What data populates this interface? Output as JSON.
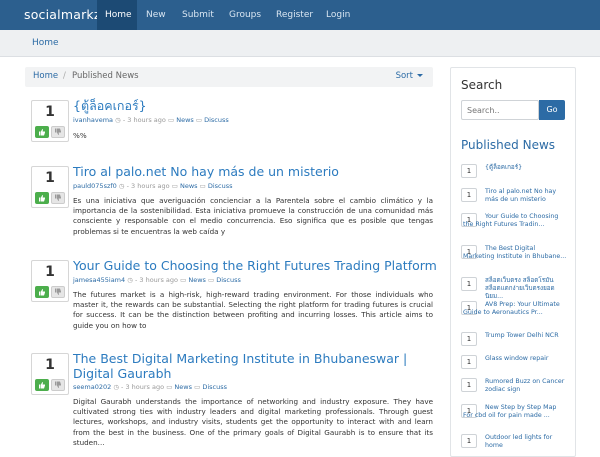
{
  "navbar": {
    "brand": "socialmarkz",
    "items": [
      {
        "label": "Home",
        "active": true
      },
      {
        "label": "New"
      },
      {
        "label": "Submit"
      },
      {
        "label": "Groups"
      },
      {
        "label": "Register"
      },
      {
        "label": "Login"
      }
    ]
  },
  "subbar": {
    "home": "Home"
  },
  "breadcrumb": {
    "home": "Home",
    "separator": "/",
    "current": "Published News",
    "sort": "Sort"
  },
  "posts": [
    {
      "votes": "1",
      "title": "{ตู้ล็อคเกอร์}",
      "author": "ivanhavema",
      "time": "3 hours ago",
      "category": "News",
      "discuss": "Discuss",
      "body": "%%"
    },
    {
      "votes": "1",
      "title": "Tiro al palo.net No hay más de un misterio",
      "author": "pauld075szf0",
      "time": "3 hours ago",
      "category": "News",
      "discuss": "Discuss",
      "body": "Es una iniciativa que averiguación concienciar a la Parentela sobre el cambio climático y la importancia de la sostenibilidad. Esta iniciativa promueve la construcción de una comunidad más consciente y responsable con el medio concurrencia. Eso significa que es posible que tengas problemas si te encuentras la web caída y"
    },
    {
      "votes": "1",
      "title": "Your Guide to Choosing the Right Futures Trading Platform",
      "author": "jamesa455iam4",
      "time": "3 hours ago",
      "category": "News",
      "discuss": "Discuss",
      "body": "The futures market is a high-risk, high-reward trading environment. For those individuals who master it, the rewards can be substantial. Selecting the right platform for trading futures is crucial for success. It can be the distinction between profiting and incurring losses. This article aims to guide you on how to"
    },
    {
      "votes": "1",
      "title": "The Best Digital Marketing Institute in Bhubaneswar | Digital Gaurabh",
      "author": "seema0202",
      "time": "3 hours ago",
      "category": "News",
      "discuss": "Discuss",
      "body": "Digital Gaurabh understands the importance of networking and industry exposure. They have cultivated strong ties with industry leaders and digital marketing professionals. Through guest lectures, workshops, and industry visits, students get the opportunity to interact with and learn from the best in the business. One of the primary goals of Digital Gaurabh is to ensure that its studen..."
    }
  ],
  "sidebar": {
    "search_title": "Search",
    "search_placeholder": "Search..",
    "go_label": "Go",
    "published_title": "Published News",
    "items": [
      {
        "count": "1",
        "text": "{ตู้ล็อคเกอร์}"
      },
      {
        "count": "1",
        "text": "Tiro al palo.net No hay más de un misterio"
      },
      {
        "count": "1",
        "text": "Your Guide to Choosing the Right Futures Tradin..."
      },
      {
        "count": "1",
        "text": "The Best Digital Marketing Institute in Bhubane..."
      },
      {
        "count": "1",
        "text": "สล็อตเว็บตรง สล็อตโรมัน สล็อตแตกง่ายเว็บตรงยอดนิยม..."
      },
      {
        "count": "1",
        "text": "AV8 Prep: Your Ultimate Guide to Aeronautics Pr..."
      },
      {
        "count": "1",
        "text": "Trump Tower Delhi NCR"
      },
      {
        "count": "1",
        "text": "Glass window repair"
      },
      {
        "count": "1",
        "text": "Rumored Buzz on Cancer zodiac sign"
      },
      {
        "count": "1",
        "text": "New Step by Step Map For cbd oil for pain made ..."
      },
      {
        "count": "1",
        "text": "Outdoor led lights for home"
      }
    ]
  },
  "colors": {
    "navbar": "#2c5f8e",
    "accent": "#2c6ba5",
    "upvote": "#4cae4c"
  }
}
